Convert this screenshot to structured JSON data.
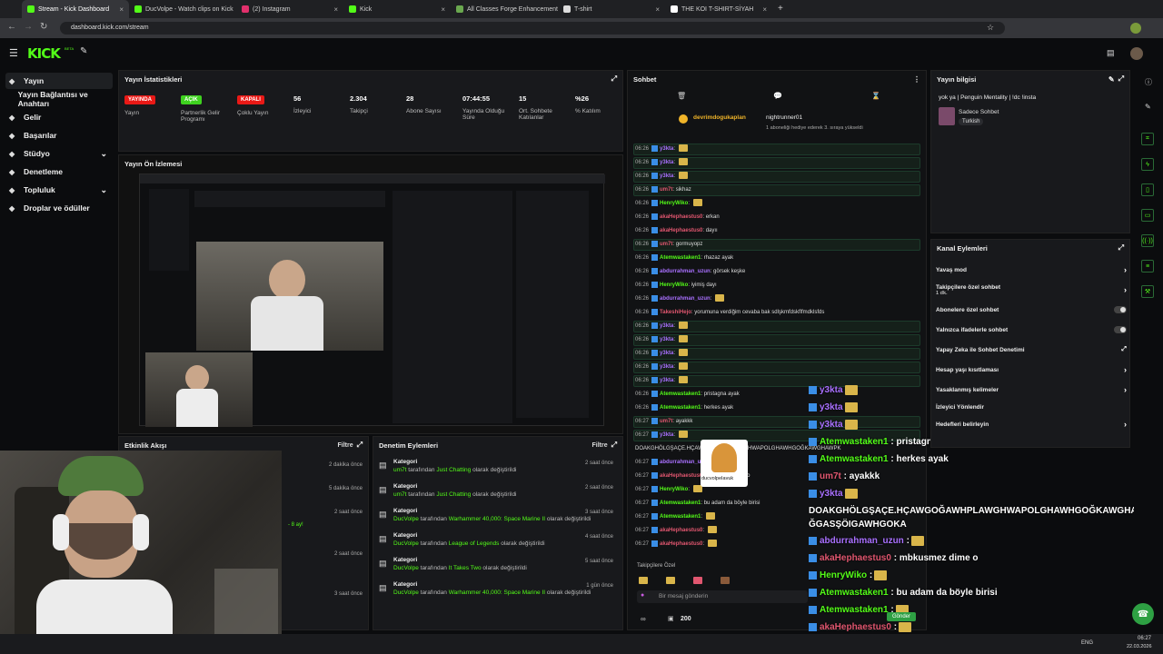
{
  "browser": {
    "tabs": [
      {
        "label": "Stream - Kick Dashboard",
        "color": "#53fc18",
        "active": true
      },
      {
        "label": "DucVolpe - Watch clips on Kick",
        "color": "#53fc18"
      },
      {
        "label": "(2) Instagram",
        "color": "#e1306c"
      },
      {
        "label": "Kick",
        "color": "#53fc18"
      },
      {
        "label": "All Classes Forge Enhancement",
        "color": "#6aa84f"
      },
      {
        "label": "T-shirt",
        "color": "#dddddd"
      },
      {
        "label": "THE KOI T-SHIRT-SİYAH",
        "color": "#ffffff"
      }
    ],
    "url": "dashboard.kick.com/stream",
    "new_tab": "+"
  },
  "nav": {
    "logo": "KICK",
    "logo_sup": "BETA"
  },
  "sidebar": {
    "items": [
      {
        "label": "Yayın",
        "icon": "broadcast-icon",
        "active": true
      },
      {
        "label": "Yayın Bağlantısı ve Anahtarı"
      },
      {
        "label": "Gelir",
        "icon": "money-icon"
      },
      {
        "label": "Başarılar",
        "icon": "trophy-icon"
      },
      {
        "label": "Stüdyo",
        "icon": "studio-icon",
        "expand": "⌄"
      },
      {
        "label": "Denetleme",
        "icon": "hammer-icon"
      },
      {
        "label": "Topluluk",
        "icon": "community-icon",
        "expand": "⌄"
      },
      {
        "label": "Droplar ve ödüller",
        "icon": "gift-icon"
      }
    ]
  },
  "stats": {
    "title": "Yayın İstatistikleri",
    "items": [
      {
        "value": "YAYINDA",
        "label": "Yayın",
        "badge_color": "#e91916"
      },
      {
        "value": "AÇIK",
        "label": "Partnerlik Gelir Programı",
        "badge_color": "#3ed21f"
      },
      {
        "value": "KAPALI",
        "label": "Çoklu Yayın",
        "badge_color": "#e91916"
      },
      {
        "value": "56",
        "label": "İzleyici"
      },
      {
        "value": "2.304",
        "label": "Takipçi"
      },
      {
        "value": "28",
        "label": "Abone Sayısı"
      },
      {
        "value": "07:44:55",
        "label": "Yayında Olduğu Süre"
      },
      {
        "value": "15",
        "label": "Ort. Sohbete Katılanlar"
      },
      {
        "value": "%26",
        "label": "% Katılım"
      }
    ]
  },
  "preview": {
    "title": "Yayın Ön İzlemesi"
  },
  "activity": {
    "title": "Etkinlik Akışı",
    "filter": "Filtre",
    "times": [
      "2 dakika önce",
      "5 dakika önce",
      "2 saat önce",
      "2 saat önce",
      "3 saat önce"
    ],
    "extra": "- 8 ay!"
  },
  "moderation": {
    "title": "Denetim Eylemleri",
    "filter": "Filtre",
    "rows": [
      {
        "title": "Kategori",
        "user": "um7t",
        "mid": " tarafından ",
        "game": "Just Chatting",
        "end": " olarak değiştirildi",
        "when": "2 saat önce"
      },
      {
        "title": "Kategori",
        "user": "um7t",
        "mid": " tarafından ",
        "game": "Just Chatting",
        "end": " olarak değiştirildi",
        "when": "2 saat önce"
      },
      {
        "title": "Kategori",
        "user": "DucVolpe",
        "mid": " tarafından ",
        "game": "Warhammer 40,000: Space Marine II",
        "end": " olarak değiştirildi",
        "when": "3 saat önce"
      },
      {
        "title": "Kategori",
        "user": "DucVolpe",
        "mid": " tarafından ",
        "game": "League of Legends",
        "end": " olarak değiştirildi",
        "when": "4 saat önce"
      },
      {
        "title": "Kategori",
        "user": "DucVolpe",
        "mid": " tarafından ",
        "game": "It Takes Two",
        "end": " olarak değiştirildi",
        "when": "5 saat önce"
      },
      {
        "title": "Kategori",
        "user": "DucVolpe",
        "mid": " tarafından ",
        "game": "Warhammer 40,000: Space Marine II",
        "end": " olarak değiştirildi",
        "when": "1 gün önce"
      }
    ]
  },
  "chat": {
    "title": "Sohbet",
    "pinned_user1": "devrimdogukaplan",
    "pinned_user2": "nightrunner01",
    "pinned_note": "1 aboneliği hediye ederek 3. sıraya yükseldi",
    "lines": [
      {
        "time": "06:26",
        "user": "y3kta",
        "color": "#a970ff",
        "msg": "",
        "hl": true
      },
      {
        "time": "06:26",
        "user": "y3kta",
        "color": "#a970ff",
        "msg": "",
        "hl": true
      },
      {
        "time": "06:26",
        "user": "y3kta",
        "color": "#a970ff",
        "msg": "",
        "hl": true
      },
      {
        "time": "06:26",
        "user": "um7t",
        "color": "#e0566f",
        "msg": "sikhaz",
        "hl": true
      },
      {
        "time": "06:26",
        "user": "HenryWiko",
        "color": "#53fc18",
        "msg": ""
      },
      {
        "time": "06:26",
        "user": "akaHephaestus0",
        "color": "#e0566f",
        "msg": "erkan"
      },
      {
        "time": "06:26",
        "user": "akaHephaestus0",
        "color": "#e0566f",
        "msg": "dayıı"
      },
      {
        "time": "06:26",
        "user": "um7t",
        "color": "#e0566f",
        "msg": "gormuyopz",
        "hl": true
      },
      {
        "time": "06:26",
        "user": "Atemwastaken1",
        "color": "#53fc18",
        "msg": "rhazaz ayak"
      },
      {
        "time": "06:26",
        "user": "abdurrahman_uzun",
        "color": "#a970ff",
        "msg": "görsek keşke"
      },
      {
        "time": "06:26",
        "user": "HenryWiko",
        "color": "#53fc18",
        "msg": "iyimiş dayı"
      },
      {
        "time": "06:26",
        "user": "abdurrahman_uzun",
        "color": "#a970ff",
        "msg": ""
      },
      {
        "time": "06:26",
        "user": "TakeshiHejo",
        "color": "#e0566f",
        "msg": "yorumuna verdiğim cevaba bak sdlşkmfdskflfmdklsfds"
      },
      {
        "time": "06:26",
        "user": "y3kta",
        "color": "#a970ff",
        "msg": "",
        "hl": true
      },
      {
        "time": "06:26",
        "user": "y3kta",
        "color": "#a970ff",
        "msg": "",
        "hl": true
      },
      {
        "time": "06:26",
        "user": "y3kta",
        "color": "#a970ff",
        "msg": "",
        "hl": true
      },
      {
        "time": "06:26",
        "user": "y3kta",
        "color": "#a970ff",
        "msg": "",
        "hl": true
      },
      {
        "time": "06:26",
        "user": "y3kta",
        "color": "#a970ff",
        "msg": "",
        "hl": true
      },
      {
        "time": "06:26",
        "user": "Atemwastaken1",
        "color": "#53fc18",
        "msg": "pristagna ayak"
      },
      {
        "time": "06:26",
        "user": "Atemwastaken1",
        "color": "#53fc18",
        "msg": "herkes ayak"
      },
      {
        "time": "06:27",
        "user": "um7t",
        "color": "#e0566f",
        "msg": "ayakkk",
        "hl": true
      },
      {
        "time": "06:27",
        "user": "y3kta",
        "color": "#a970ff",
        "msg": "",
        "hl": true
      },
      {
        "time": "",
        "user": "",
        "color": "#ffffff",
        "msg": "DOAKGHÖLGŞAÇE.HÇAWGOĞAWHPLAWGHWAPOLGHAWHGOĞKAWGHAWPK"
      },
      {
        "time": "06:27",
        "user": "abdurrahman_uzun",
        "color": "#a970ff",
        "msg": ""
      },
      {
        "time": "06:27",
        "user": "akaHephaestus0",
        "color": "#e0566f",
        "msg": "mbkusmez dime o"
      },
      {
        "time": "06:27",
        "user": "HenryWiko",
        "color": "#53fc18",
        "msg": ""
      },
      {
        "time": "06:27",
        "user": "Atemwastaken1",
        "color": "#53fc18",
        "msg": "bu adam da böyle birisi"
      },
      {
        "time": "06:27",
        "user": "Atemwastaken1",
        "color": "#53fc18",
        "msg": ""
      },
      {
        "time": "06:27",
        "user": "akaHephaestus0",
        "color": "#e0566f",
        "msg": ""
      },
      {
        "time": "06:27",
        "user": "akaHephaestus0",
        "color": "#e0566f",
        "msg": ""
      }
    ],
    "followers_label": "Takipçilere Özel",
    "input_placeholder": "Bir mesaj gönderin",
    "viewer_count": "200",
    "card_user": "ducvolpeIavuk"
  },
  "overlay_chat": [
    {
      "user": "y3kta",
      "color": "#a970ff",
      "msg": ""
    },
    {
      "user": "y3kta",
      "color": "#a970ff",
      "msg": ""
    },
    {
      "user": "y3kta",
      "color": "#a970ff",
      "msg": ""
    },
    {
      "user": "Atemwastaken1",
      "color": "#53fc18",
      "msg": " : pristagna ayak"
    },
    {
      "user": "Atemwastaken1",
      "color": "#53fc18",
      "msg": " : herkes ayak"
    },
    {
      "user": "um7t",
      "color": "#e0566f",
      "msg": " : ayakkk"
    },
    {
      "user": "y3kta",
      "color": "#a970ff",
      "msg": ""
    },
    {
      "user": "",
      "color": "#ffffff",
      "msg": "DOAKGHÖLGŞAÇE.HÇAWGOĞAWHPLAWGHWAPOLGHAWHGOĞKAWGHAWPK"
    },
    {
      "user": "",
      "color": "#ffffff",
      "msg": "ĞGASŞÖIGAWHGOKA"
    },
    {
      "user": "abdurrahman_uzun",
      "color": "#a970ff",
      "msg": " :"
    },
    {
      "user": "akaHephaestus0",
      "color": "#e0566f",
      "msg": " : mbkusmez dime o"
    },
    {
      "user": "HenryWiko",
      "color": "#53fc18",
      "msg": " :"
    },
    {
      "user": "Atemwastaken1",
      "color": "#53fc18",
      "msg": " : bu adam da böyle birisi"
    },
    {
      "user": "Atemwastaken1",
      "color": "#53fc18",
      "msg": " :"
    },
    {
      "user": "akaHephaestus0",
      "color": "#e0566f",
      "msg": " :"
    },
    {
      "user": "akaHephaestus0",
      "color": "#e0566f",
      "msg": " :"
    }
  ],
  "stream_info": {
    "title": "Yayın bilgisi",
    "stream_title": "yok ya | Penguin Mentality | !dc !insta",
    "mode": "Sadece Sohbet",
    "language": "Turkish"
  },
  "channel_actions": {
    "title": "Kanal Eylemleri",
    "rows": [
      {
        "label": "Yavaş mod",
        "ctrl": "arrow"
      },
      {
        "label": "Takipçilere özel sohbet",
        "sub": "1 dk.",
        "ctrl": "arrow"
      },
      {
        "label": "Abonelere özel sohbet",
        "ctrl": "toggle"
      },
      {
        "label": "Yalnızca ifadelerle sohbet",
        "ctrl": "toggle"
      },
      {
        "label": "Yapay Zeka ile Sohbet Denetimi",
        "ctrl": "ext"
      },
      {
        "label": "Hesap yaşı kısıtlaması",
        "ctrl": "arrow"
      },
      {
        "label": "Yasaklanmış kelimeler",
        "ctrl": "arrow"
      },
      {
        "label": "İzleyici Yönlendir",
        "ctrl": "none"
      },
      {
        "label": "Hedefleri belirleyin",
        "ctrl": "arrow"
      }
    ]
  },
  "taskbar": {
    "lang": "ENG",
    "time": "06:27",
    "date": "22.03.2026",
    "send": "Gönder"
  }
}
